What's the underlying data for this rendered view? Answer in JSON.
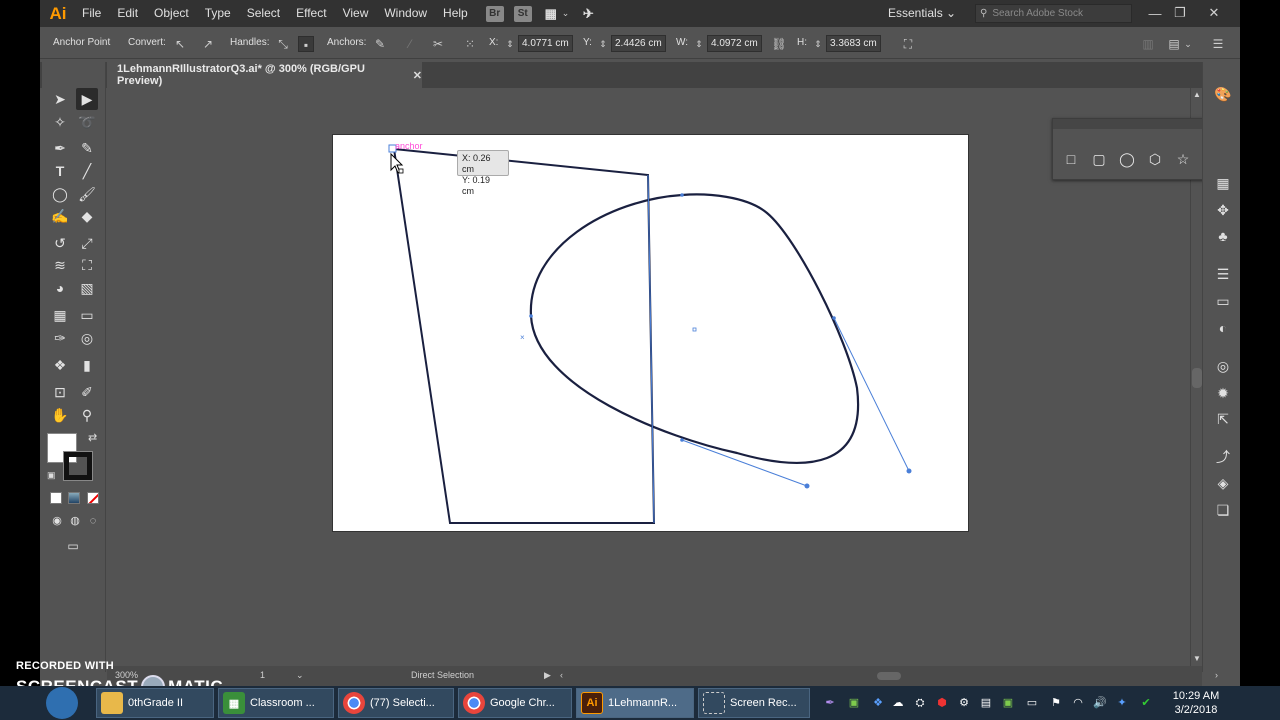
{
  "menubar": {
    "logo": "Ai",
    "items": [
      "File",
      "Edit",
      "Object",
      "Type",
      "Select",
      "Effect",
      "View",
      "Window",
      "Help"
    ],
    "bridge": "Br",
    "stock": "St",
    "workspace": "Essentials",
    "search_placeholder": "Search Adobe Stock"
  },
  "controlbar": {
    "tool_label": "Anchor Point",
    "convert_label": "Convert:",
    "handles_label": "Handles:",
    "anchors_label": "Anchors:",
    "x_label": "X:",
    "x_value": "4.0771 cm",
    "y_label": "Y:",
    "y_value": "2.4426 cm",
    "w_label": "W:",
    "w_value": "4.0972 cm",
    "h_label": "H:",
    "h_value": "3.3683 cm"
  },
  "document": {
    "tab_title": "1LehmannRIllustratorQ3.ai* @ 300% (RGB/GPU Preview)"
  },
  "canvas": {
    "anchor_hint": "anchor",
    "tooltip_x": "X: 0.26 cm",
    "tooltip_y": "Y: 0.19 cm"
  },
  "statusbar": {
    "zoom": "300%",
    "artboard_num": "1",
    "tool_status": "Direct Selection"
  },
  "watermark": {
    "line1": "RECORDED WITH",
    "line2a": "SCREENCAST",
    "line2b": "MATIC"
  },
  "taskbar": {
    "items": [
      {
        "label": "0thGrade II"
      },
      {
        "label": "Classroom ..."
      },
      {
        "label": "(77) Selecti..."
      },
      {
        "label": "Google Chr..."
      },
      {
        "label": "1LehmannR..."
      },
      {
        "label": "Screen Rec..."
      }
    ],
    "time": "10:29 AM",
    "date": "3/2/2018"
  },
  "colors": {
    "path_stroke": "#1a2040",
    "handle_line": "#4a7fd8",
    "anchor_pink": "#ff4bd8",
    "ai_orange": "#ff9a00"
  }
}
